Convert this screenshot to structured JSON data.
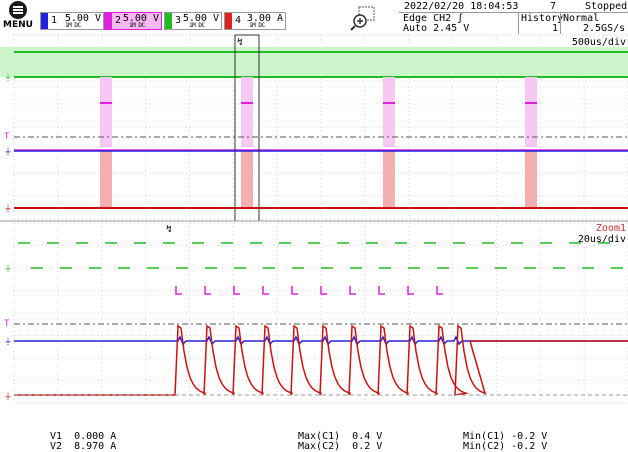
{
  "header": {
    "menu_label": "MENU",
    "datetime": "2022/02/20 18:04:53",
    "acq_count": "7",
    "run_state": "Stopped",
    "trigger": "Edge CH2 ʃ",
    "trigger_level": "Auto 2.45 V",
    "history_label": "History",
    "history_value": "1",
    "mode": "Normal",
    "sample_rate": "2.5GS/s"
  },
  "channels": [
    {
      "num": "1",
      "scale": "5.00 V",
      "sub": "1M DC",
      "color": "#2222dd",
      "selected": false
    },
    {
      "num": "2",
      "scale": "5.00 V",
      "sub": "1M DC",
      "color": "#dd22dd",
      "selected": true
    },
    {
      "num": "3",
      "scale": "5.00 V",
      "sub": "1M DC",
      "color": "#22bb22",
      "selected": false
    },
    {
      "num": "4",
      "scale": "3.00 A",
      "sub": "1M DC",
      "color": "#dd2222",
      "selected": false
    }
  ],
  "main": {
    "timebase": "500us/div"
  },
  "zoom": {
    "label": "Zoom1",
    "timebase": "20us/div"
  },
  "measurements": {
    "v1": "V1  0.000 A",
    "v2": "V2  8.970 A",
    "max_c1": "Max(C1)  0.4 V",
    "max_c2": "Max(C2)  0.2 V",
    "min_c1": "Min(C1) -0.2 V",
    "min_c2": "Min(C2) -0.2 V"
  },
  "colors": {
    "grid": "#cfcfcf",
    "ch1": "#2222dd",
    "ch2": "#dd22dd",
    "ch3": "#22bb22",
    "ch4": "#cc1111",
    "ch3_fill": "#ccf5cc",
    "ch2_band": "#f6c8f3",
    "ch4_band": "#f4b0b0"
  },
  "icons": {
    "menu": "menu-icon",
    "zoom": "zoom-in-icon",
    "trigger_marker": "trigger-marker-icon"
  }
}
